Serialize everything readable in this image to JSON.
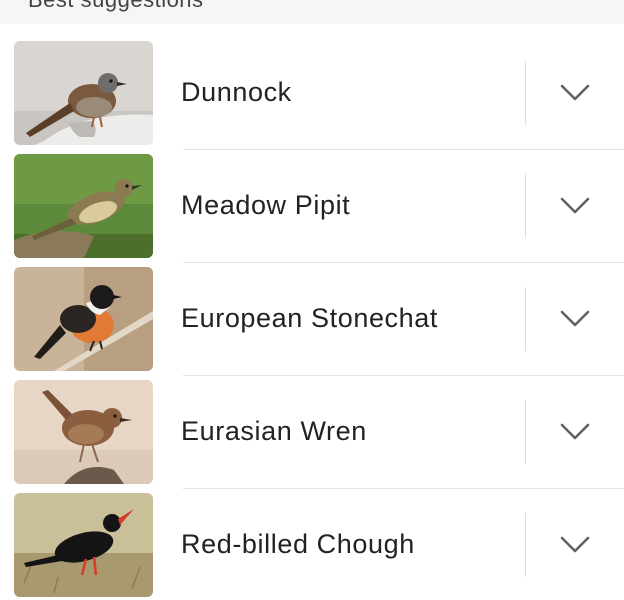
{
  "section": {
    "header": "Best suggestions"
  },
  "suggestions": [
    {
      "name": "Dunnock",
      "expand_icon": "chevron-down-icon"
    },
    {
      "name": "Meadow Pipit",
      "expand_icon": "chevron-down-icon"
    },
    {
      "name": "European Stonechat",
      "expand_icon": "chevron-down-icon"
    },
    {
      "name": "Eurasian Wren",
      "expand_icon": "chevron-down-icon"
    },
    {
      "name": "Red-billed Chough",
      "expand_icon": "chevron-down-icon"
    }
  ],
  "colors": {
    "text": "#222222",
    "divider": "#dddddd",
    "chevron": "#5f6368",
    "header_bg": "#f6f6f6"
  }
}
